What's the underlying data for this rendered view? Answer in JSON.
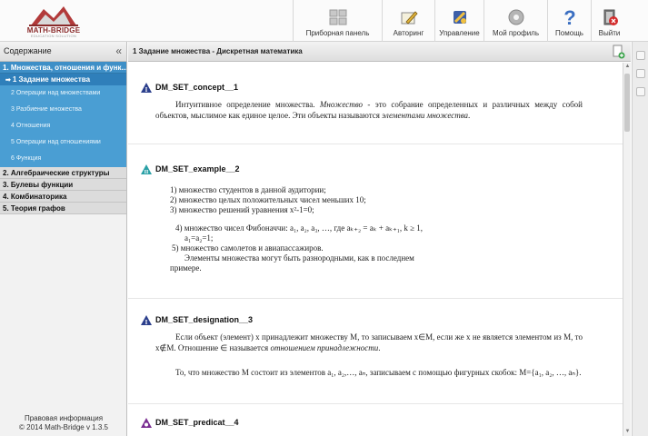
{
  "app": {
    "logo_name": "MATH-BRIDGE",
    "logo_sub": "EDUCATION SOLUTION"
  },
  "toolbar": [
    {
      "name": "dashboard",
      "label": "Приборная панель",
      "icon": "dashboard-icon",
      "width": 98
    },
    {
      "name": "authoring",
      "label": "Авторинг",
      "icon": "pen-icon",
      "width": 58
    },
    {
      "name": "management",
      "label": "Управление",
      "icon": "tools-icon",
      "width": 54
    },
    {
      "name": "profile",
      "label": "Мой профиль",
      "icon": "gear-icon",
      "width": 70
    },
    {
      "name": "help",
      "label": "Помощь",
      "icon": "help-icon",
      "width": 48
    },
    {
      "name": "logout",
      "label": "Выйти",
      "icon": "exit-icon",
      "width": 40
    }
  ],
  "sidebar": {
    "title": "Содержание",
    "collapse_glyph": "«",
    "items": [
      {
        "label": "1. Множества, отношения и функ...",
        "level": 1,
        "state": "active"
      },
      {
        "label": "1 Задание множества",
        "level": 2,
        "state": "selected"
      },
      {
        "label": "2 Операции над множествами",
        "level": 2,
        "state": ""
      },
      {
        "label": "3 Разбиение множества",
        "level": 2,
        "state": ""
      },
      {
        "label": "4 Отношения",
        "level": 2,
        "state": ""
      },
      {
        "label": "5 Операции над отношениями",
        "level": 2,
        "state": ""
      },
      {
        "label": "6 Функция",
        "level": 2,
        "state": ""
      },
      {
        "label": "2. Алгебраические структуры",
        "level": 1,
        "state": ""
      },
      {
        "label": "3. Булевы функции",
        "level": 1,
        "state": ""
      },
      {
        "label": "4. Комбинаторика",
        "level": 1,
        "state": ""
      },
      {
        "label": "5. Теория графов",
        "level": 1,
        "state": ""
      }
    ],
    "footer_line1": "Правовая информация",
    "footer_line2": "© 2014 Math-Bridge v 1.3.5"
  },
  "main": {
    "title": "1 Задание множества - Дискретная математика",
    "blocks": [
      {
        "name": "DM_SET_concept__1",
        "badge": "I",
        "color": "#2b3f8c"
      },
      {
        "name": "DM_SET_example__2",
        "badge": "II",
        "color": "#2aa0a6"
      },
      {
        "name": "DM_SET_designation__3",
        "badge": "I",
        "color": "#2b3f8c"
      },
      {
        "name": "DM_SET_predicat__4",
        "badge": "o",
        "color": "#7a2e92"
      }
    ],
    "concept": {
      "p1a": "Интуитивное определение множества. ",
      "p1b": "Множество",
      "p1c": " - это собрание определенных и различных между собой объектов, мыслимое как единое целое. Эти объекты называются ",
      "p1d": "элементами множества",
      "p1e": "."
    },
    "example": {
      "l1": "1)  множество студентов в данной аудитории;",
      "l2": "2)  множество целых положительных чисел меньших 10;",
      "l3": "3)  множество решений уравнения x²-1=0;",
      "l4": "4)  множество чисел Фибоначчи: a₁, a₂, a₃, …, где aₖ₊₂ = aₖ + aₖ₊₁, k ≥ 1,",
      "l4b": "a₁=a₂=1;",
      "l5": "5)  множество самолетов и авиапассажиров.",
      "l6": "Элементы множества могут быть разнородными, как в последнем",
      "l7": "примере."
    },
    "designation": {
      "t1": "Если объект (элемент) x принадлежит множеству M, то записываем x∈M, если же x не является элементом из M, то x∉M. Отношение ∈ называется ",
      "t1it": "отношением принадлежности",
      "t1end": ".",
      "t2": "То, что множество M состоит из элементов a₁, a₂,…, aₙ, записываем с помощью фигурных скобок: M={a₁, a₂, …, aₙ}."
    }
  },
  "colors": {
    "accent": "#3e8fc7",
    "selected": "#2f7fba",
    "sub": "#4a9ed3"
  }
}
